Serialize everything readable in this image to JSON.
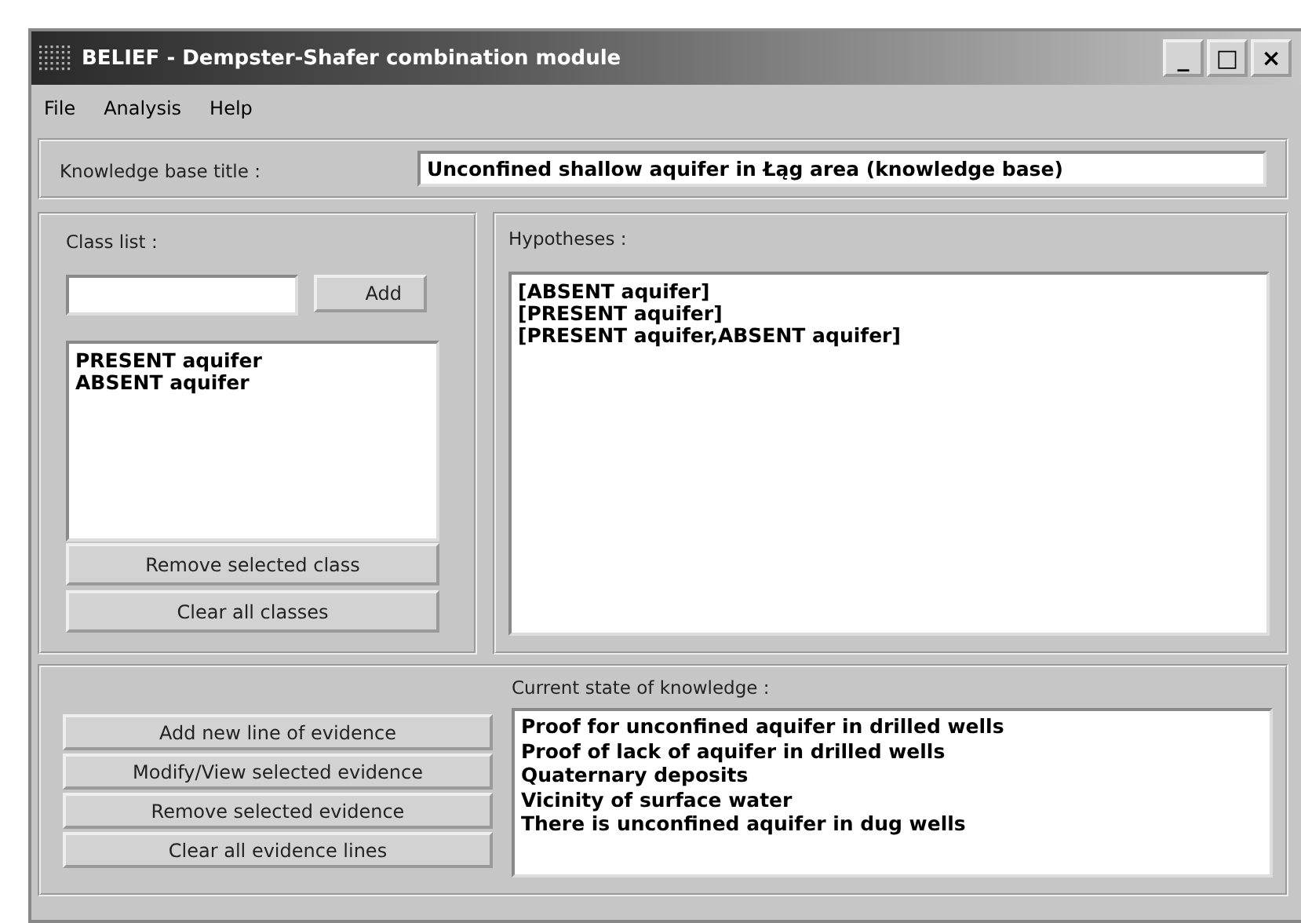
{
  "window": {
    "title": "BELIEF - Dempster-Shafer combination module",
    "controls": [
      "_",
      "□",
      "×"
    ]
  },
  "menu": [
    "File",
    "Analysis",
    "Help"
  ],
  "knowledge_base": {
    "label": "Knowledge base title :",
    "value": "Unconfined shallow aquifer in Łąg area (knowledge base)"
  },
  "class_list": {
    "label": "Class list :",
    "add_button": "Add",
    "items": [
      "PRESENT aquifer",
      "ABSENT aquifer"
    ],
    "buttons": [
      "Remove selected class",
      "Clear all classes"
    ]
  },
  "hypotheses": {
    "label": "Hypotheses :",
    "items": [
      "[ABSENT aquifer]",
      "[PRESENT aquifer]",
      "[PRESENT aquifer,ABSENT aquifer]"
    ]
  },
  "evidence": {
    "buttons": [
      "Add new line of evidence",
      "Modify/View selected evidence",
      "Remove selected evidence",
      "Clear all evidence lines"
    ],
    "label": "Current state of knowledge :",
    "items": [
      "Proof for unconfined aquifer in drilled wells",
      "Proof of lack of aquifer in drilled wells",
      "Quaternary deposits",
      "Vicinity of surface water",
      "There is unconfined aquifer in dug wells"
    ]
  }
}
